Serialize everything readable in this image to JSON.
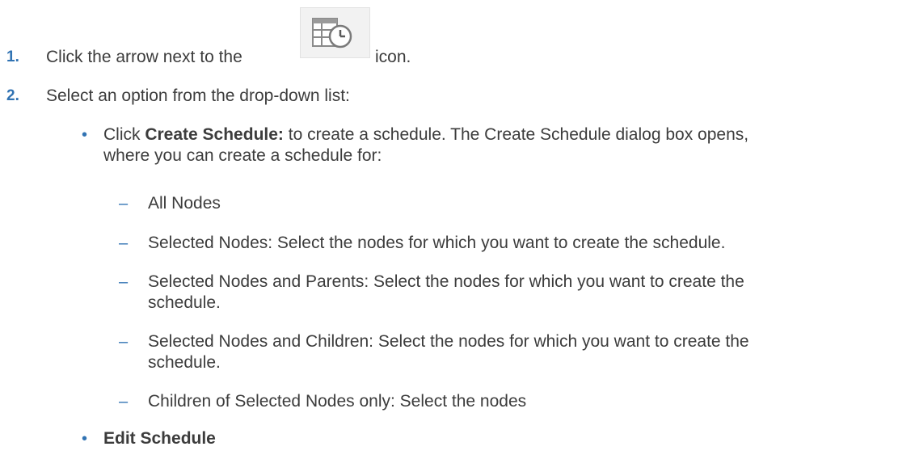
{
  "steps": [
    {
      "number": "1.",
      "text_before": "Click the arrow next to the",
      "icon": "schedule-icon",
      "text_after": "icon."
    },
    {
      "number": "2.",
      "text": "Select an option from the drop-down list:"
    }
  ],
  "bullets": {
    "create": {
      "prefix": "Click",
      "bold": "Create Schedule:",
      "suffix": "to create a schedule. The Create Schedule dialog box opens,",
      "line2": "where you can create a schedule for:"
    },
    "edit": {
      "bold": "Edit Schedule"
    }
  },
  "sub_items": {
    "all": "All Nodes",
    "selected": "Selected Nodes: Select the nodes for which you want to create the schedule.",
    "parents_line1": "Selected Nodes and Parents: Select the nodes for which you want to create the",
    "parents_line2": "schedule.",
    "children_line1": "Selected Nodes and Children: Select the nodes for which you want to create the",
    "children_line2": "schedule.",
    "only": "Children of Selected Nodes only: Select the nodes"
  },
  "markers": {
    "bullet": "•",
    "dash": "–"
  }
}
